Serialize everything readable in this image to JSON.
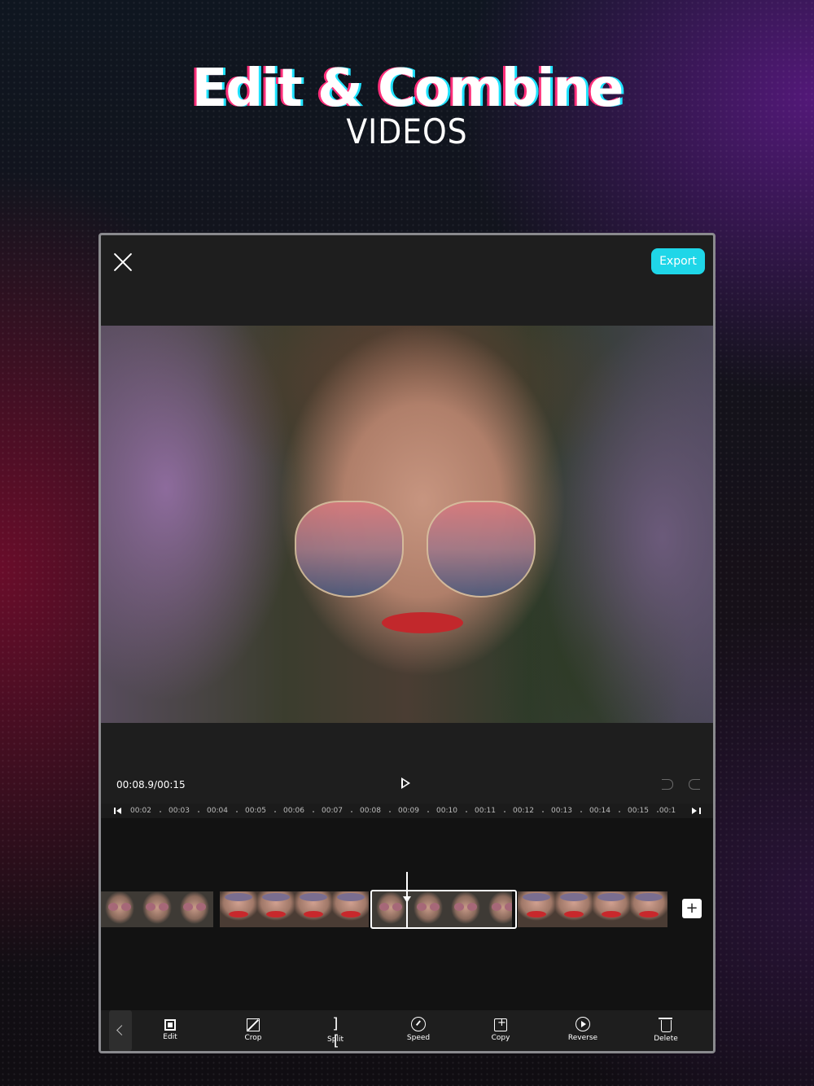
{
  "headline": {
    "title": "Edit & Combine",
    "subtitle": "VIDEOS"
  },
  "app": {
    "export_label": "Export",
    "time_display": "00:08.9/00:15",
    "ruler_ticks": [
      "00:02",
      "00:03",
      "00:04",
      "00:05",
      "00:06",
      "00:07",
      "00:08",
      "00:09",
      "00:10",
      "00:11",
      "00:12",
      "00:13",
      "00:14",
      "00:15",
      "00:1"
    ],
    "add_clip_label": "+",
    "toolbar": {
      "edit": "Edit",
      "crop": "Crop",
      "split": "Split",
      "speed": "Speed",
      "copy": "Copy",
      "reverse": "Reverse",
      "delete": "Delete"
    }
  },
  "colors": {
    "accent": "#1fd6e8",
    "panel": "#1e1e1e",
    "timeline": "#121212"
  }
}
